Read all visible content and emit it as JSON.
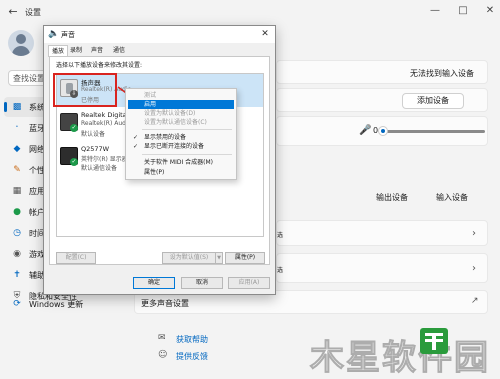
{
  "settings": {
    "app_title": "设置",
    "search_placeholder": "查找设置",
    "nav": [
      {
        "icon": "display-icon",
        "label": "系统"
      },
      {
        "icon": "bluetooth-icon",
        "label": "蓝牙和其他设备"
      },
      {
        "icon": "network-icon",
        "label": "网络和 Internet"
      },
      {
        "icon": "brush-icon",
        "label": "个性化"
      },
      {
        "icon": "apps-icon",
        "label": "应用"
      },
      {
        "icon": "account-icon",
        "label": "帐户"
      },
      {
        "icon": "time-icon",
        "label": "时间和语言"
      },
      {
        "icon": "gaming-icon",
        "label": "游戏"
      },
      {
        "icon": "accessibility-icon",
        "label": "辅助功能"
      },
      {
        "icon": "privacy-icon",
        "label": "隐私和安全性"
      },
      {
        "icon": "windows-update-icon",
        "label": "Windows 更新"
      }
    ],
    "main": {
      "no_input_device": "无法找到输入设备",
      "add_device_button": "添加设备",
      "volume_value": "0",
      "output_device_label": "输出设备",
      "input_device_label": "输入设备",
      "row_text_1": "选",
      "row_text_2": "选",
      "more_sound_settings": "更多声音设置",
      "get_help": "获取帮助",
      "feedback": "提供反馈"
    }
  },
  "dialog": {
    "title": "声音",
    "tabs": [
      "播放",
      "录制",
      "声音",
      "通信"
    ],
    "active_tab": 0,
    "instruction": "选择以下播放设备来修改其设置:",
    "devices": [
      {
        "name": "扬声器",
        "driver": "Realtek(R) Audio",
        "status": "已停用",
        "badge": "down",
        "selected": true
      },
      {
        "name": "Realtek Digital O",
        "driver": "Realtek(R) Audio",
        "status": "默认设备",
        "badge": "check",
        "selected": false
      },
      {
        "name": "Q2577W",
        "driver": "英特尔(R) 显示器",
        "status": "默认通信设备",
        "badge": "check",
        "selected": false
      }
    ],
    "buttons": {
      "configure": "配置(C)",
      "set_default": "设为默认值(S)",
      "properties": "属性(P)",
      "ok": "确定",
      "cancel": "取消",
      "apply": "应用(A)"
    }
  },
  "context_menu": {
    "items": [
      {
        "label": "测试",
        "disabled": true
      },
      {
        "label": "启用",
        "highlighted": true
      },
      {
        "label": "设置为默认设备(D)",
        "disabled": true
      },
      {
        "label": "设置为默认通信设备(C)",
        "disabled": true
      },
      {
        "separator": true
      },
      {
        "label": "显示禁用的设备",
        "checked": true
      },
      {
        "label": "显示已断开连接的设备",
        "checked": true
      },
      {
        "separator": true
      },
      {
        "label": "关于软件 MIDI 合成器(M)"
      },
      {
        "label": "属性(P)"
      }
    ]
  },
  "watermark": {
    "text": "木星软件园"
  },
  "colors": {
    "accent": "#0067c0",
    "highlight_box": "#d9241f",
    "menu_highlight": "#0078d7",
    "selected_row": "#cce4f7"
  }
}
